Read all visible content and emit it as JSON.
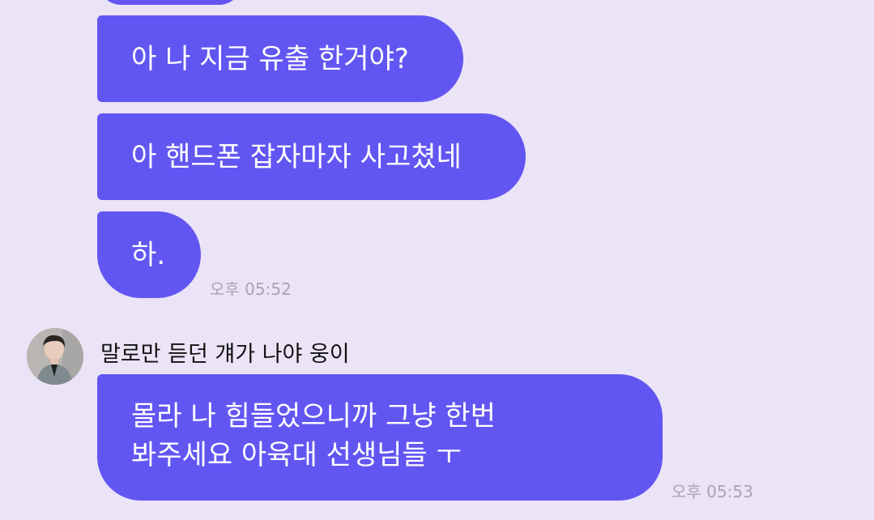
{
  "messages": [
    {
      "text": "아 나 지금 유출 한거야?"
    },
    {
      "text": "아 핸드폰 잡자마자 사고쳤네"
    },
    {
      "text": "하.",
      "time": "오후 05:52"
    }
  ],
  "reply": {
    "sender": "말로만 듣던 걔가 나야 웅이",
    "lines": [
      "몰라 나 힘들었으니까 그냥 한번",
      "봐주세요 아육대 선생님들 ㅜ"
    ],
    "time": "오후 05:53"
  },
  "colors": {
    "background": "#ebe4f7",
    "bubble": "#6256f2",
    "timestamp": "#a9a4b5"
  },
  "icons": {
    "avatar": "profile-photo"
  }
}
